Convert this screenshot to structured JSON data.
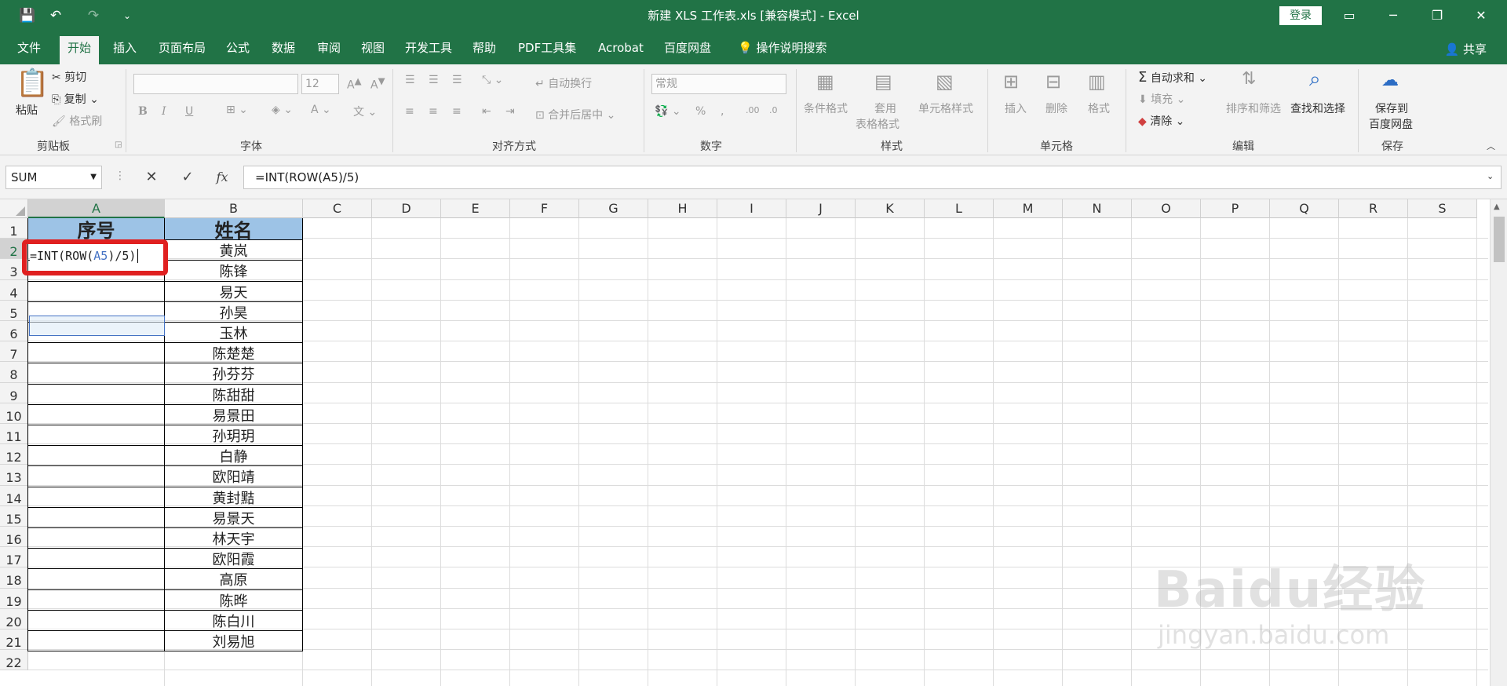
{
  "titlebar": {
    "title": "新建 XLS 工作表.xls  [兼容模式]  -  Excel",
    "login": "登录",
    "quick_access": [
      "save-icon",
      "undo-icon",
      "redo-icon",
      "customize-icon"
    ],
    "quick_access_glyphs": [
      "💾",
      "↶",
      "↷",
      "⌄"
    ]
  },
  "tabs": [
    "文件",
    "开始",
    "插入",
    "页面布局",
    "公式",
    "数据",
    "审阅",
    "视图",
    "开发工具",
    "帮助",
    "PDF工具集",
    "Acrobat",
    "百度网盘"
  ],
  "search": "操作说明搜索",
  "share": "共享",
  "ribbon": {
    "clipboard": {
      "paste": "粘贴",
      "cut": "剪切",
      "copy": "复制",
      "format_painter": "格式刷",
      "label": "剪贴板"
    },
    "font": {
      "size": "12",
      "label": "字体",
      "bold": "B",
      "italic": "I",
      "underline": "U"
    },
    "alignment": {
      "wrap": "自动换行",
      "merge": "合并后居中",
      "label": "对齐方式"
    },
    "number": {
      "format": "常规",
      "percent": "%",
      "comma": ",",
      "label": "数字"
    },
    "styles": {
      "conditional": "条件格式",
      "table_line1": "套用",
      "table_line2": "表格格式",
      "cell_styles": "单元格样式",
      "label": "样式"
    },
    "cells": {
      "insert": "插入",
      "delete": "删除",
      "format": "格式",
      "label": "单元格"
    },
    "editing": {
      "autosum": "自动求和",
      "fill": "填充",
      "clear": "清除",
      "sort": "排序和筛选",
      "find": "查找和选择",
      "label": "编辑"
    },
    "save": {
      "line1": "保存到",
      "line2": "百度网盘",
      "label": "保存"
    }
  },
  "formula_bar": {
    "name_box": "SUM",
    "cancel": "✕",
    "confirm": "✓",
    "fx": "fx",
    "formula": "=INT(ROW(A5)/5)"
  },
  "columns": [
    "A",
    "B",
    "C",
    "D",
    "E",
    "F",
    "G",
    "H",
    "I",
    "J",
    "K",
    "L",
    "M",
    "N",
    "O",
    "P",
    "Q",
    "R",
    "S"
  ],
  "rows": [
    "1",
    "2",
    "3",
    "4",
    "5",
    "6",
    "7",
    "8",
    "9",
    "10",
    "11",
    "12",
    "13",
    "14",
    "15",
    "16",
    "17",
    "18",
    "19",
    "20",
    "21",
    "22"
  ],
  "table": {
    "header_a": "序号",
    "header_b": "姓名",
    "names": [
      "黄岚",
      "陈锋",
      "易天",
      "孙昊",
      "玉林",
      "陈楚楚",
      "孙芬芬",
      "陈甜甜",
      "易景田",
      "孙玥玥",
      "白静",
      "欧阳靖",
      "黄封黠",
      "易景天",
      "林天宇",
      "欧阳霞",
      "高原",
      "陈晔",
      "陈白川",
      "刘易旭"
    ]
  },
  "editing_cell": {
    "p1": "=INT(ROW(",
    "ref": "A5",
    "p2": ")/5)"
  },
  "watermark": {
    "line1": "Baidu经验",
    "line2": "jingyan.baidu.com"
  }
}
